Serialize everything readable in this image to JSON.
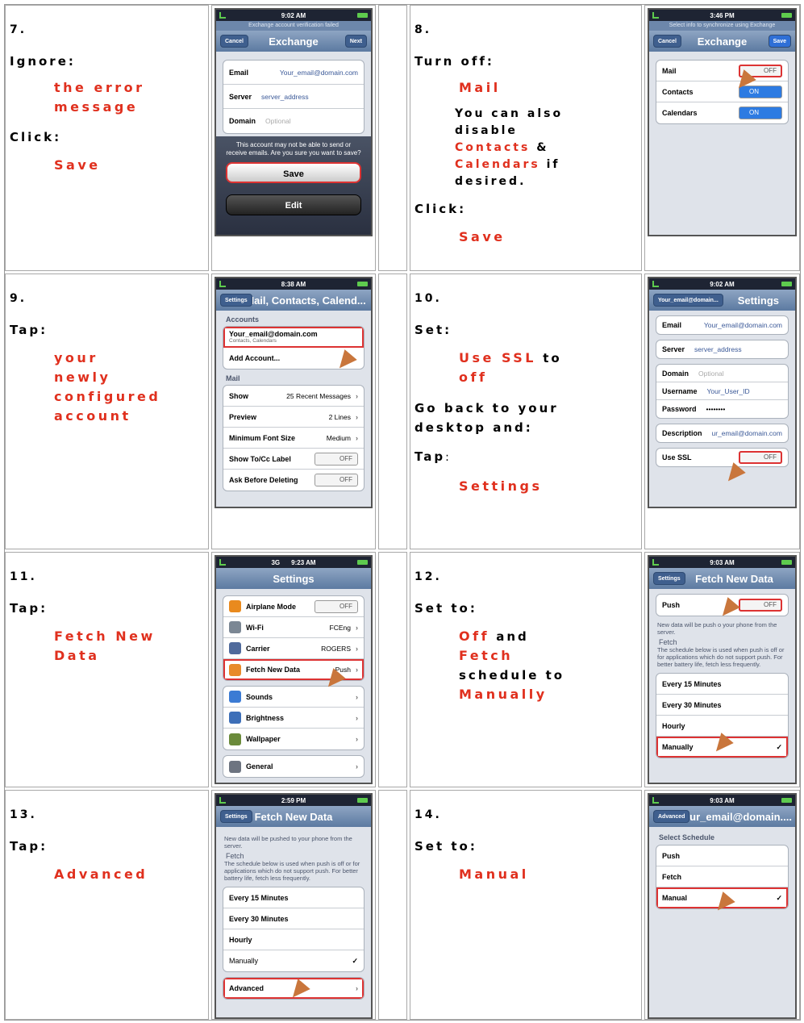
{
  "steps": {
    "s7": {
      "num": "7.",
      "a1": "Ignore:",
      "t1a": "the error",
      "t1b": "message",
      "a2": "Click:",
      "t2": "Save"
    },
    "s8": {
      "num": "8.",
      "a1": "Turn off:",
      "t1": "Mail",
      "b1": "You can also",
      "b2": "disable",
      "b3a": "Contacts",
      "b3b": " &",
      "b4a": "Calendars",
      "b4b": " if",
      "b5": "desired.",
      "a2": "Click:",
      "t2": "Save"
    },
    "s9": {
      "num": "9.",
      "a1": "Tap:",
      "t1a": "your",
      "t1b": "newly",
      "t1c": "configured",
      "t1d": "account"
    },
    "s10": {
      "num": "10.",
      "a1": "Set:",
      "t1a": "Use SSL",
      "t1b": " to",
      "t1c": "off",
      "a2a": "Go back to your",
      "a2b": "desktop and:",
      "a3": "Tap",
      "a3c": ":",
      "t3": "Settings"
    },
    "s11": {
      "num": "11.",
      "a1": "Tap:",
      "t1a": "Fetch New",
      "t1b": "Data"
    },
    "s12": {
      "num": "12.",
      "a1": "Set to:",
      "l1a": "Off",
      "l1b": " and",
      "l2": "Fetch",
      "l3": "schedule to",
      "l4": "Manually"
    },
    "s13": {
      "num": "13.",
      "a1": "Tap:",
      "t1": "Advanced"
    },
    "s14": {
      "num": "14.",
      "a1": "Set to:",
      "t1": "Manual"
    }
  },
  "phones": {
    "p7": {
      "time": "9:02 AM",
      "sub": "Exchange account verification failed",
      "title": "Exchange",
      "left": "Cancel",
      "right": "Next",
      "rows": [
        {
          "k": "Email",
          "v": "Your_email@domain.com"
        },
        {
          "k": "Server",
          "v": "server_address"
        },
        {
          "k": "Domain",
          "v": "Optional"
        }
      ],
      "msg": "This account may not be able to send or receive emails. Are you sure you want to save?",
      "save": "Save",
      "edit": "Edit"
    },
    "p8": {
      "time": "3:46 PM",
      "sub": "Select info to synchronize using Exchange",
      "title": "Exchange",
      "left": "Cancel",
      "right": "Save",
      "rows": [
        {
          "k": "Mail",
          "v": "OFF"
        },
        {
          "k": "Contacts",
          "v": "ON"
        },
        {
          "k": "Calendars",
          "v": "ON"
        }
      ]
    },
    "p9": {
      "time": "8:38 AM",
      "left": "Settings",
      "title": "Mail, Contacts, Calend...",
      "accounts": "Accounts",
      "acct": "Your_email@domain.com",
      "acctsub": "Contacts, Calendars",
      "add": "Add Account...",
      "mail": "Mail",
      "rows": [
        {
          "k": "Show",
          "v": "25 Recent Messages"
        },
        {
          "k": "Preview",
          "v": "2 Lines"
        },
        {
          "k": "Minimum Font Size",
          "v": "Medium"
        },
        {
          "k": "Show To/Cc Label",
          "v": "OFF"
        },
        {
          "k": "Ask Before Deleting",
          "v": "OFF"
        }
      ]
    },
    "p10": {
      "time": "9:02 AM",
      "left": "Your_email@domain...",
      "title": "Settings",
      "rows": [
        {
          "k": "Email",
          "v": "Your_email@domain.com"
        },
        {
          "k": "Server",
          "v": "server_address"
        },
        {
          "k": "Domain",
          "v": "Optional"
        },
        {
          "k": "Username",
          "v": "Your_User_ID"
        },
        {
          "k": "Password",
          "v": "••••••••"
        },
        {
          "k": "Description",
          "v": "ur_email@domain.com"
        },
        {
          "k": "Use SSL",
          "v": "OFF"
        }
      ]
    },
    "p11": {
      "time": "9:23 AM",
      "net": "3G",
      "title": "Settings",
      "rows": [
        {
          "k": "Airplane Mode",
          "v": "OFF"
        },
        {
          "k": "Wi-Fi",
          "v": "FCEng"
        },
        {
          "k": "Carrier",
          "v": "ROGERS"
        },
        {
          "k": "Fetch New Data",
          "v": "Push"
        },
        {
          "k": "Sounds",
          "v": ""
        },
        {
          "k": "Brightness",
          "v": ""
        },
        {
          "k": "Wallpaper",
          "v": ""
        },
        {
          "k": "General",
          "v": ""
        }
      ]
    },
    "p12": {
      "time": "9:03 AM",
      "left": "Settings",
      "title": "Fetch New Data",
      "push": "Push",
      "pushv": "OFF",
      "note": "New data will be push      o your phone from the server.",
      "fetch": "Fetch",
      "fnote": "The schedule below is used when push is off or for applications which do not support push. For better battery life, fetch less frequently.",
      "opts": [
        "Every 15 Minutes",
        "Every 30 Minutes",
        "Hourly",
        "Manually"
      ],
      "check": "✓"
    },
    "p13": {
      "time": "2:59 PM",
      "left": "Settings",
      "title": "Fetch New Data",
      "note": "New data will be pushed to your phone from the server.",
      "fetch": "Fetch",
      "fnote": "The schedule below is used when push is off or for applications which do not support push. For better battery life, fetch less frequently.",
      "opts": [
        "Every 15 Minutes",
        "Every 30 Minutes",
        "Hourly",
        "Manually"
      ],
      "check": "✓",
      "adv": "Advanced"
    },
    "p14": {
      "time": "9:03 AM",
      "left": "Advanced",
      "title": "Your_email@domain....",
      "sel": "Select Schedule",
      "opts": [
        "Push",
        "Fetch",
        "Manual"
      ],
      "check": "✓"
    }
  },
  "colors": {
    "accent": "#e0301e",
    "nav": "#5c7aa1",
    "toggle_on": "#2d7be2"
  }
}
